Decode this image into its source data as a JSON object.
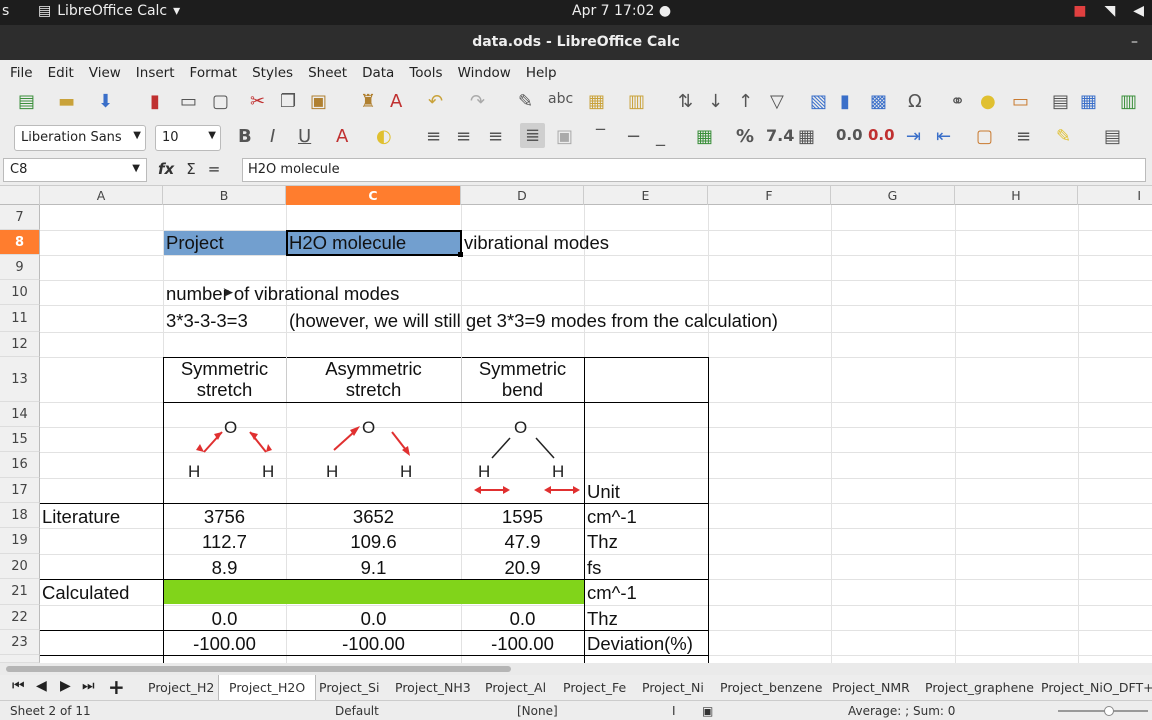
{
  "topbar": {
    "app": "LibreOffice Calc",
    "clock": "Apr 7  17:02"
  },
  "window": {
    "title": "data.ods - LibreOffice Calc",
    "minimize": "–"
  },
  "menu": [
    "File",
    "Edit",
    "View",
    "Insert",
    "Format",
    "Styles",
    "Sheet",
    "Data",
    "Tools",
    "Window",
    "Help"
  ],
  "format": {
    "font_name": "Liberation Sans",
    "font_size": "10"
  },
  "formula_bar": {
    "name_box": "C8",
    "content": "H2O molecule",
    "fx": "fx",
    "sigma": "Σ",
    "equals": "="
  },
  "columns": [
    "A",
    "B",
    "C",
    "D",
    "E",
    "F",
    "G",
    "H",
    "I"
  ],
  "selected_column": "C",
  "rows": [
    "7",
    "8",
    "9",
    "10",
    "11",
    "12",
    "13",
    "14",
    "15",
    "16",
    "17",
    "18",
    "19",
    "20",
    "21",
    "22",
    "23"
  ],
  "selected_row": "8",
  "cells": {
    "b8": "Project",
    "c8": "H2O molecule",
    "d8": "vibrational modes",
    "b10": "number of vibrational modes",
    "b11": "3*3-3-3=3",
    "c11": "(however, we will still get 3*3=9 modes from the calculation)",
    "h_sym_stretch_1": "Symmetric",
    "h_sym_stretch_2": "stretch",
    "h_asym_stretch_1": "Asymmetric",
    "h_asym_stretch_2": "stretch",
    "h_sym_bend_1": "Symmetric",
    "h_sym_bend_2": "bend",
    "e17": "Unit",
    "a18": "Literature",
    "b18": "3756",
    "c18": "3652",
    "d18": "1595",
    "e18": "cm^-1",
    "b19": "112.7",
    "c19": "109.6",
    "d19": "47.9",
    "e19": "Thz",
    "b20": "8.9",
    "c20": "9.1",
    "d20": "20.9",
    "e20": "fs",
    "a21": "Calculated",
    "e21": "cm^-1",
    "b22": "0.0",
    "c22": "0.0",
    "d22": "0.0",
    "e22": "Thz",
    "b23": "-100.00",
    "c23": "-100.00",
    "d23": "-100.00",
    "e23": "Deviation(%)"
  },
  "molecule_atoms": {
    "o": "O",
    "h": "H"
  },
  "colors": {
    "project_fill": "#729fcf",
    "calculated_fill": "#81d41a",
    "selection": "#ff7d2e",
    "arrow": "#e03030"
  },
  "sheet_tabs": [
    "Project_H2",
    "Project_H2O",
    "Project_Si",
    "Project_NH3",
    "Project_Al",
    "Project_Fe",
    "Project_Ni",
    "Project_benzene",
    "Project_NMR",
    "Project_graphene",
    "Project_NiO_DFT+U"
  ],
  "active_tab": "Project_H2O",
  "status": {
    "sheet": "Sheet 2 of 11",
    "style": "Default",
    "lang": "[None]",
    "summary": "Average: ; Sum: 0"
  }
}
